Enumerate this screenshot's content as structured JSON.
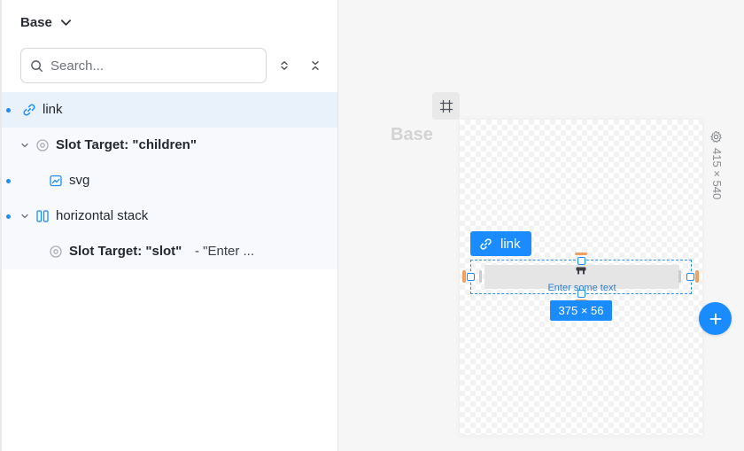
{
  "sidebar": {
    "variant_title": "Base",
    "search": {
      "placeholder": "Search...",
      "value": ""
    },
    "tree": [
      {
        "label": "link",
        "selected": true,
        "icon": "link-icon"
      },
      {
        "label": "Slot Target: \"children\"",
        "icon": "slot-target-icon"
      },
      {
        "label": "svg",
        "icon": "image-icon"
      },
      {
        "label": "horizontal stack",
        "icon": "horizontal-stack-icon"
      },
      {
        "label": "Slot Target: \"slot\"",
        "value": "-  \"Enter ...",
        "icon": "slot-target-icon"
      }
    ]
  },
  "canvas": {
    "frame_name": "Base",
    "frame_size": "415 × 540",
    "selection_label": "link",
    "selection_size": "375  ×  56",
    "placeholder_text": "Enter some text"
  },
  "colors": {
    "accent": "#1a8cff",
    "selected_row": "#e9f1fb",
    "padding_handle": "#f0a060"
  }
}
